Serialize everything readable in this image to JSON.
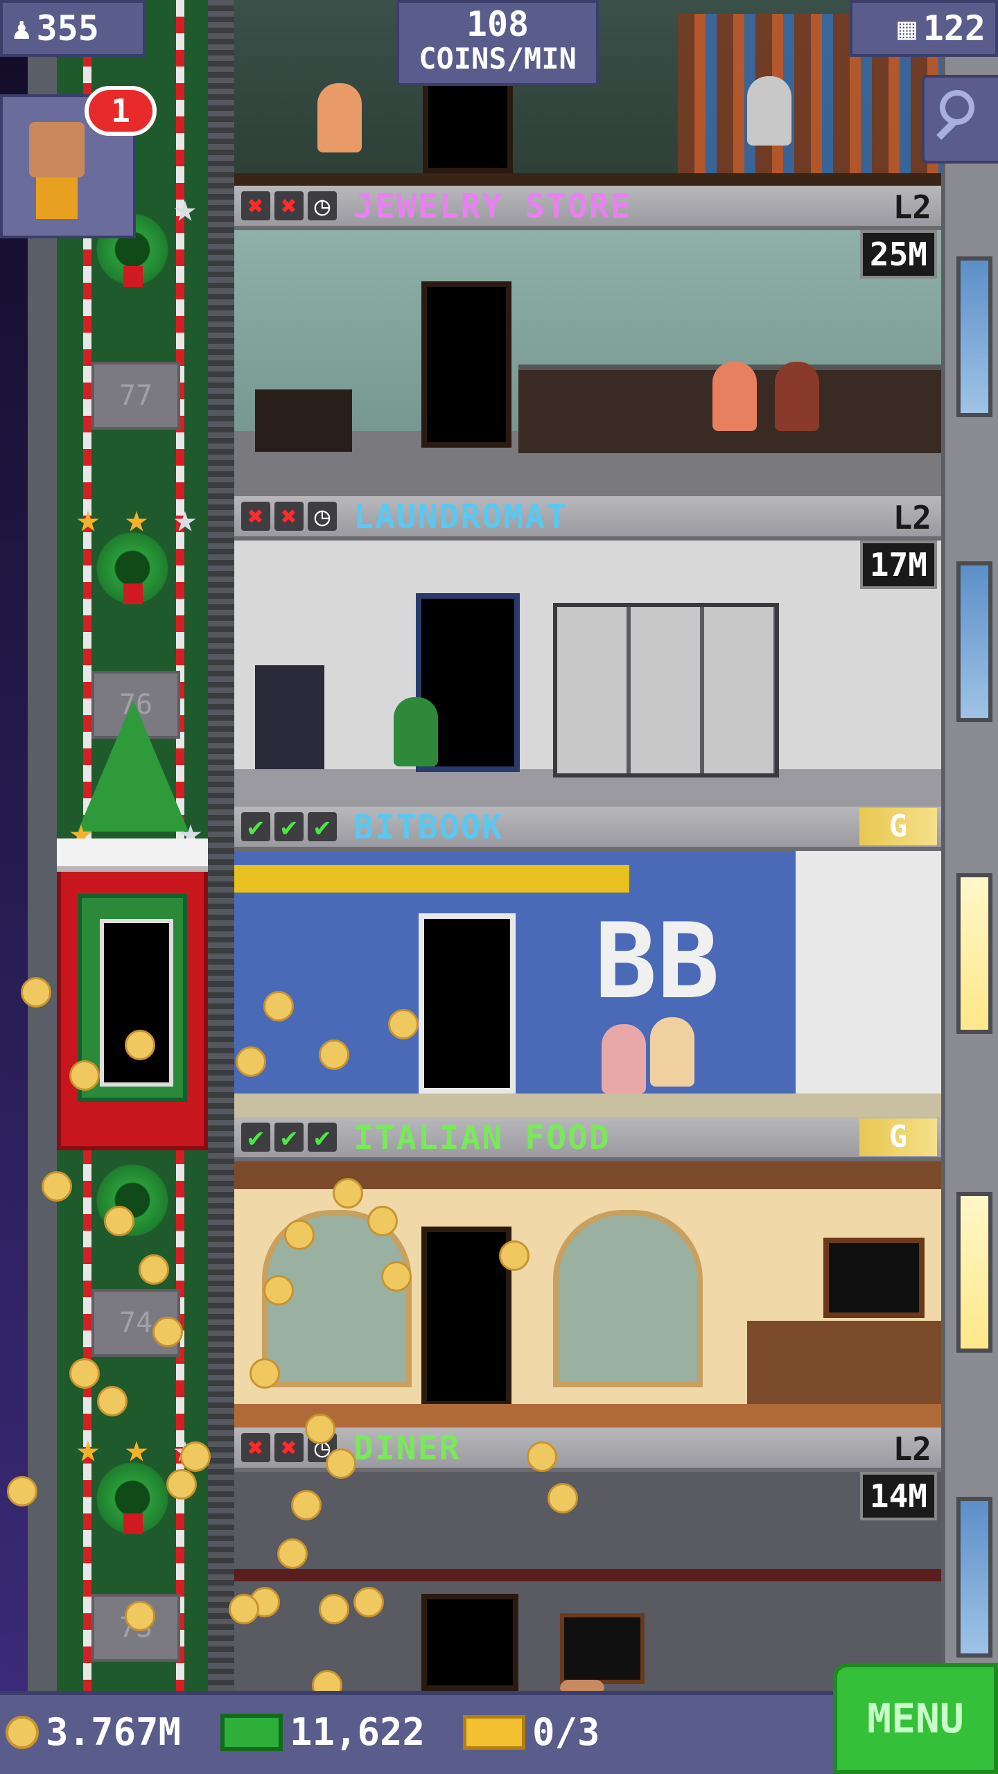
{
  "hud": {
    "population": "355",
    "population_icon": "person-icon",
    "coins_per_min_value": "108",
    "coins_per_min_label": "COINS/MIN",
    "floors": "122",
    "floors_icon": "building-icon",
    "notification_count": "1"
  },
  "floors": [
    {
      "name": "JEWELRY STORE",
      "name_color": "#e880f0",
      "status": [
        "x",
        "x",
        "clock"
      ],
      "level": "L2",
      "timer": "25M"
    },
    {
      "name": "LAUNDROMAT",
      "name_color": "#5ac8f0",
      "status": [
        "x",
        "x",
        "clock"
      ],
      "level": "L2",
      "timer": "17M"
    },
    {
      "name": "BITBOOK",
      "name_color": "#5ac8f0",
      "status": [
        "ok",
        "ok",
        "ok"
      ],
      "badge": "G",
      "room_sign": "BB"
    },
    {
      "name": "ITALIAN FOOD",
      "name_color": "#7ae85a",
      "status": [
        "ok",
        "ok",
        "ok"
      ],
      "badge": "G"
    },
    {
      "name": "DINER",
      "name_color": "#7ae85a",
      "status": [
        "x",
        "x",
        "clock"
      ],
      "level": "L2",
      "timer": "14M"
    }
  ],
  "shaft": {
    "floor_numbers": [
      "77",
      "76",
      "74",
      "73"
    ]
  },
  "bottom_bar": {
    "coins": "3.767M",
    "bux": "11,622",
    "tickets": "0/3",
    "menu_label": "MENU"
  },
  "colors": {
    "hud_bg": "#5a5c8c",
    "menu_green": "#34c038",
    "elevator_red": "#c7161e"
  }
}
